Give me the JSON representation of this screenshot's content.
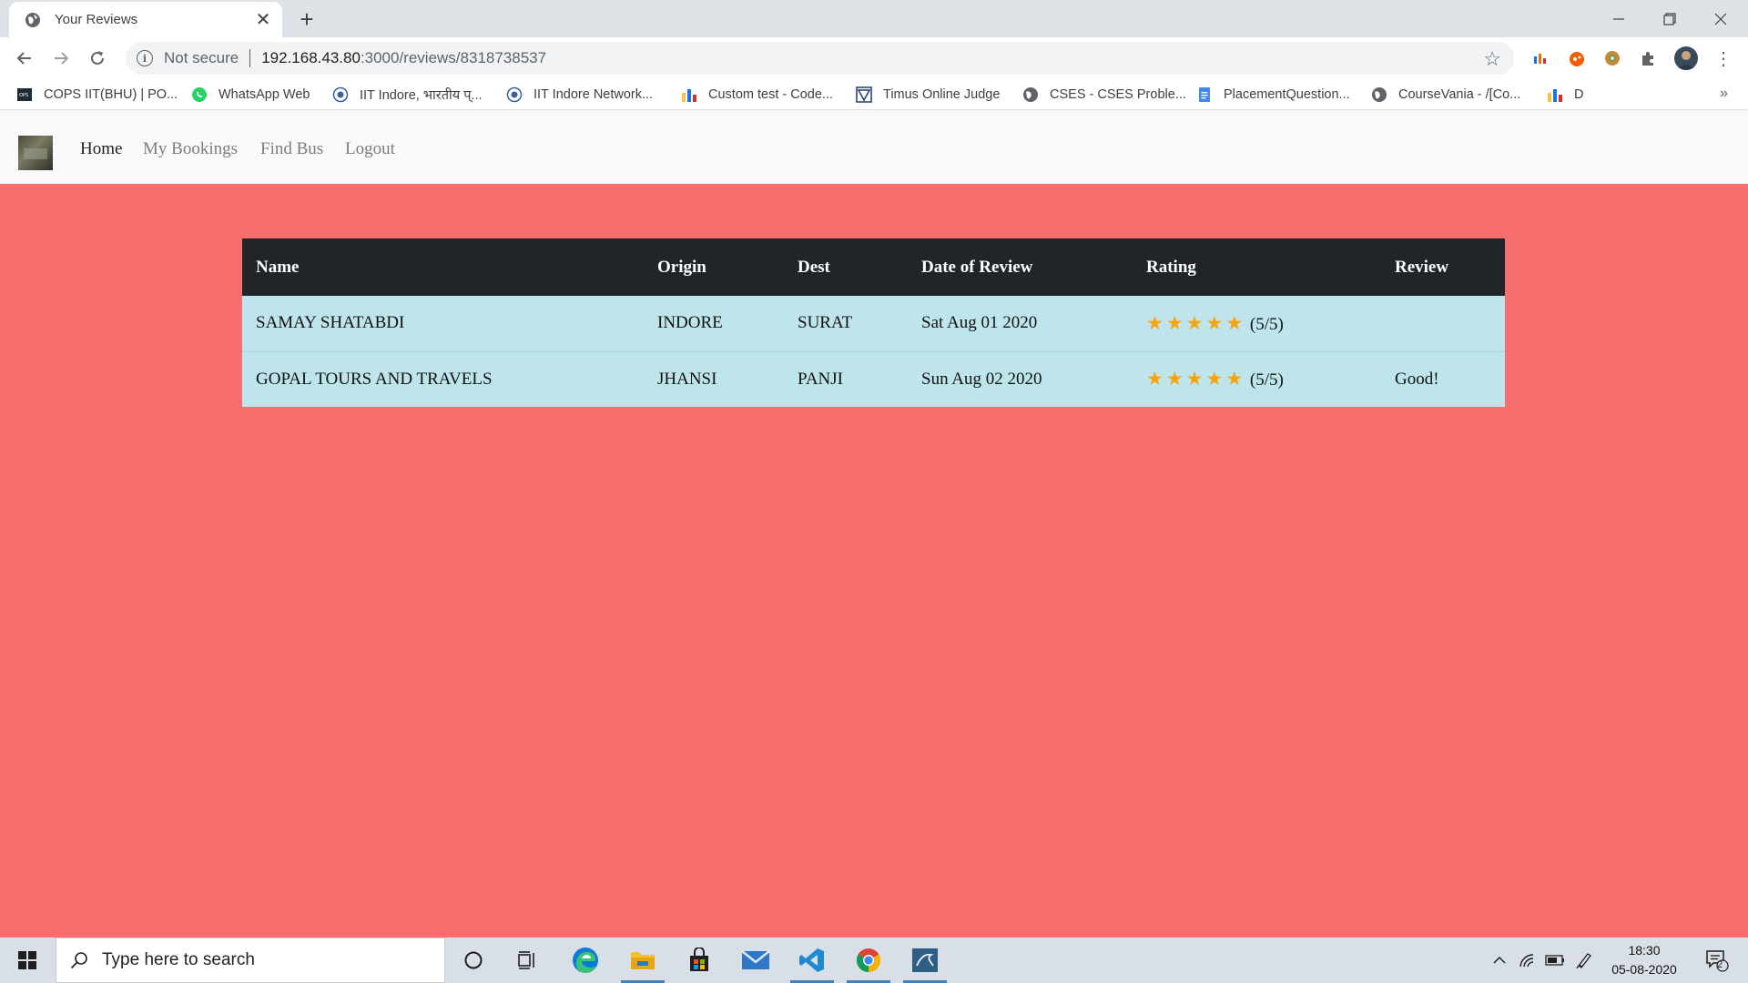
{
  "browser": {
    "tab_title": "Your Reviews",
    "new_tab_symbol": "+",
    "security_label": "Not secure",
    "url_host": "192.168.43.80",
    "url_path": ":3000/reviews/8318738537",
    "bookmarks": [
      {
        "label": "COPS IIT(BHU) | PO...",
        "icon": "cops-icon"
      },
      {
        "label": "WhatsApp Web",
        "icon": "whatsapp-icon"
      },
      {
        "label": "IIT Indore, भारतीय प्...",
        "icon": "iit-indore-icon"
      },
      {
        "label": "IIT Indore Network...",
        "icon": "iit-indore-network-icon"
      },
      {
        "label": "Custom test - Code...",
        "icon": "codeforces-icon"
      },
      {
        "label": "Timus Online Judge",
        "icon": "timus-icon"
      },
      {
        "label": "CSES - CSES Proble...",
        "icon": "globe-icon"
      },
      {
        "label": "PlacementQuestion...",
        "icon": "docs-icon"
      },
      {
        "label": "CourseVania - /[Co...",
        "icon": "globe-icon"
      },
      {
        "label": "D",
        "icon": "codeforces-icon"
      }
    ],
    "bookmarks_overflow": "»"
  },
  "site_nav": {
    "links": [
      "Home",
      "My Bookings",
      "Find Bus",
      "Logout"
    ],
    "active": "Home"
  },
  "reviews_table": {
    "headers": [
      "Name",
      "Origin",
      "Dest",
      "Date of Review",
      "Rating",
      "Review"
    ],
    "rows": [
      {
        "name": "SAMAY SHATABDI",
        "origin": "INDORE",
        "dest": "SURAT",
        "date": "Sat Aug 01 2020",
        "stars": 5,
        "rating_text": "(5/5)",
        "review": ""
      },
      {
        "name": "GOPAL TOURS AND TRAVELS",
        "origin": "JHANSI",
        "dest": "PANJI",
        "date": "Sun Aug 02 2020",
        "stars": 5,
        "rating_text": "(5/5)",
        "review": "Good!"
      }
    ]
  },
  "colors": {
    "page_background": "#f76e6e",
    "table_header": "#212529",
    "table_row": "#bee5eb",
    "star": "#f7a40f"
  },
  "taskbar": {
    "search_placeholder": "Type here to search",
    "time": "18:30",
    "date": "05-08-2020",
    "notification_count": "2"
  }
}
